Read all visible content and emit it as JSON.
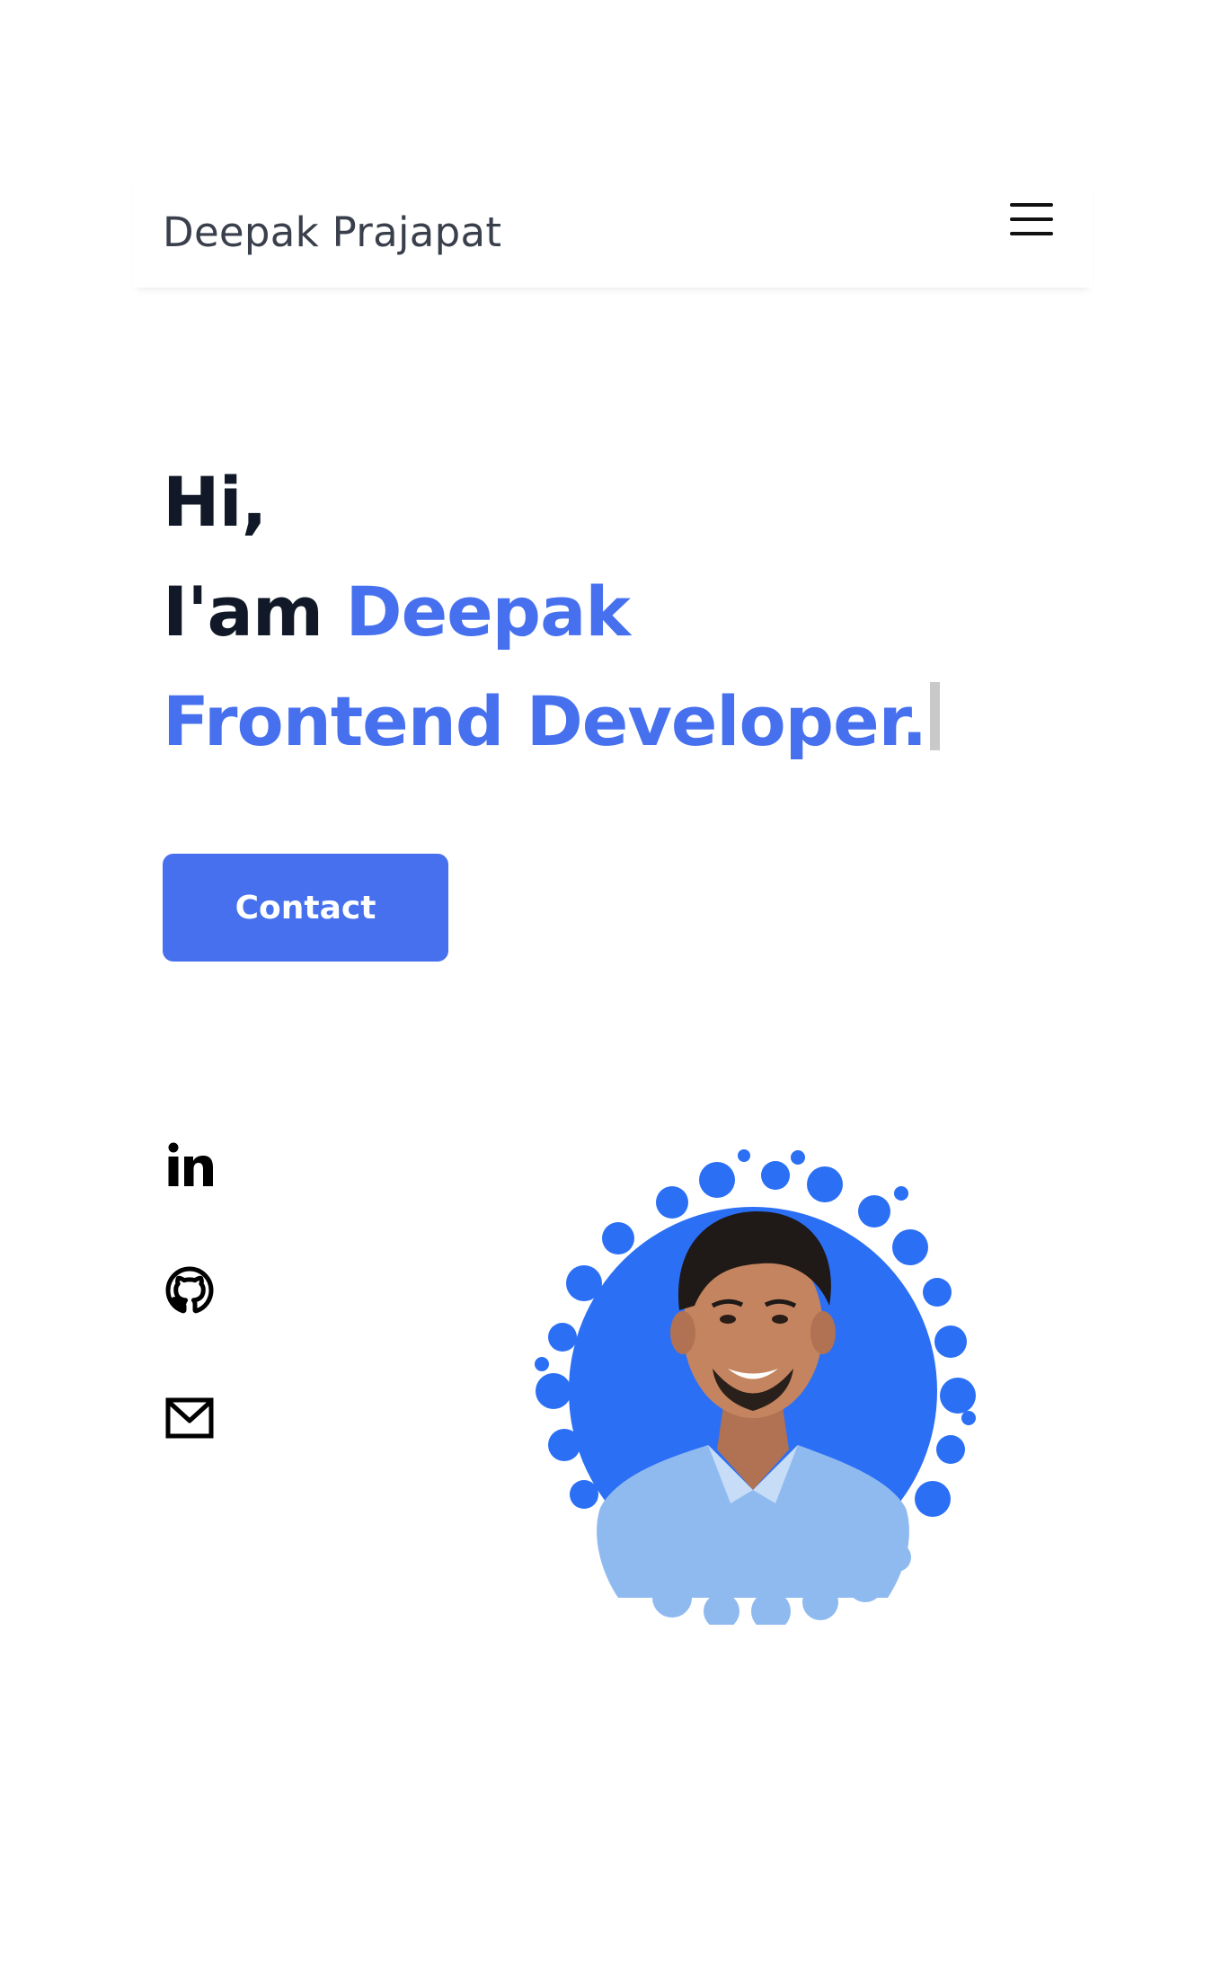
{
  "header": {
    "logo_text": "Deepak Prajapat",
    "menu_icon": "hamburger-menu-icon"
  },
  "hero": {
    "greeting": "Hi,",
    "intro_prefix": "I'am",
    "name": "Deepak",
    "role": "Frontend Developer.",
    "contact_label": "Contact"
  },
  "social": [
    {
      "icon": "linkedin-icon",
      "label": "LinkedIn"
    },
    {
      "icon": "github-icon",
      "label": "GitHub"
    },
    {
      "icon": "mail-icon",
      "label": "Email"
    }
  ],
  "colors": {
    "accent": "#4670ee",
    "text": "#111827",
    "splash": "#2b6ff5",
    "shirt": "#8fbaf0"
  }
}
